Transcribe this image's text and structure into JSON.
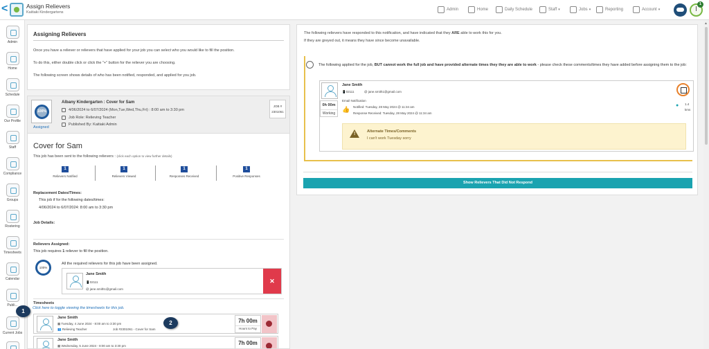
{
  "header": {
    "title": "Assign Relievers",
    "subtitle": "Kaitiaki Kindergartens",
    "nav": {
      "admin": "Admin",
      "home": "Home",
      "daily_schedule": "Daily Schedule",
      "staff": "Staff",
      "jobs": "Jobs",
      "reporting": "Reporting",
      "account": "Account"
    },
    "notification_count": "1"
  },
  "sidebar": {
    "items": [
      "Admin",
      "Home",
      "Schedule",
      "Our Profile",
      "Staff",
      "Compliance",
      "Groups",
      "Rostering",
      "Timesheets",
      "Calendar",
      "Publi...",
      "Current Jobs"
    ]
  },
  "intro": {
    "title": "Assigning Relievers",
    "p1": "Once you have a reliever or relievers that have applied for your job you can select who you would like to fill the position.",
    "p2": "To do this, either double click or click the \"+\" button for the reliever you are choosing.",
    "p3": "The following screen shows details of who has been notified, responded, and applied for you job."
  },
  "job": {
    "progress_label": "100%",
    "assigned_label": "Assigned",
    "title": "Albany Kindergarten : Cover for Sam",
    "dates": "4/06/2024 to 6/07/2024  (Mon,Tue,Wed,Thu,Fri)  :  8:00 am to 3:30 pm",
    "role": "Job Role: Relieving Teacher",
    "published": "Published By: Kaitiaki Admin",
    "job_no_label": "JOB #",
    "job_no": "2301061",
    "heading": "Cover for Sam",
    "sent_text": "This job has been sent to the following relievers :",
    "sent_hint": "(click each option to view further details)",
    "stats": [
      {
        "value": "1",
        "label": "Relievers Notified"
      },
      {
        "value": "1",
        "label": "Relievers Viewed"
      },
      {
        "value": "1",
        "label": "Responses Received"
      },
      {
        "value": "1",
        "label": "Positive Responses"
      }
    ],
    "replacement_title": "Replacement Dates/Times:",
    "replacement_line1": "This job if for the following dates/times:",
    "replacement_line2": "4/06/2024 to 6/07/2024: 8:00 am to 3:30 pm",
    "details_title": "Job Details:",
    "assigned_title": "Relievers Assigned:",
    "requires_pre": "This job requires ",
    "requires_num": "1",
    "requires_post": " reliever to fill the position.",
    "assigned_pct": "100%",
    "all_assigned": "All the required relievers for this job have been assigned.",
    "reliever_name": "Jane Smith",
    "reliever_phone": "02111",
    "reliever_email": "jane.smith1@gmail.com",
    "remove_symbol": "✕",
    "timesheets_title": "Timesheets",
    "timesheets_link": "Click here to toggle viewing the timesheets for this job.",
    "timesheets": [
      {
        "name": "Jane Smith",
        "date": "Tuesday, 4 June 2024 - 8:00 am to 3:30 pm",
        "role": "Relieving Teacher",
        "job": "Job #2301061 - Cover for Sam",
        "hours": "7h 00m",
        "hours_label": "Hours to Pay"
      },
      {
        "name": "Jane Smith",
        "date": "Wednesday, 5 June 2024 - 8:00 am to 3:30 pm",
        "hours": "7h 00m"
      }
    ],
    "callouts": [
      "1",
      "2"
    ]
  },
  "responses": {
    "line1_pre": "The following relievers have responded to this notification, and have indicated that they ",
    "line1_bold": "ARE",
    "line1_post": " able to work this for you.",
    "line2": "If they are greyed out, it means they have since become unavailable.",
    "partial_pre": "The following applied for the job, ",
    "partial_bold": "BUT cannot work the full job and have provided alternate times they they are able to work",
    "partial_post": " - please check these comments/times they have added before assigning them to the job:",
    "reliever": {
      "name": "Jane Smith",
      "phone": "02111",
      "email": "jane.smith1@gmail.com",
      "hours": "0h 00m",
      "status": "Working",
      "notification_type": "Email Notification",
      "notified": "Notified: Tuesday, 28 May 2024 @ 11:34 am",
      "response": "Response Received: Tuesday, 28 May 2024 @ 11:34 am",
      "distance": "1.4",
      "distance_unit": "kms"
    },
    "alert_title": "Alternate Times/Comments",
    "alert_body": "I can't work Tuesday sorry",
    "button": "Show Relievers That Did Not Respond"
  }
}
